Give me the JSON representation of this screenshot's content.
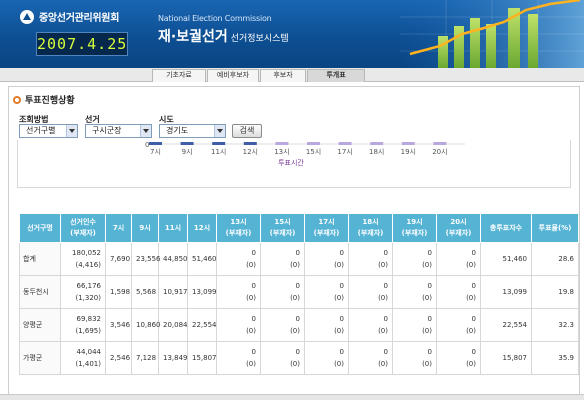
{
  "header": {
    "org_name": "중앙선거관리위원회",
    "date": "2007.4.25",
    "eng_title": "National Election Commission",
    "kor_title": "재·보궐선거",
    "kor_subtitle": "선거정보시스템"
  },
  "tabs": [
    {
      "label": "기초자료"
    },
    {
      "label": "예비후보자"
    },
    {
      "label": "후보자"
    },
    {
      "label": "투개표"
    }
  ],
  "section": {
    "title": "투표진행상황"
  },
  "filters": {
    "method_label": "조회방법",
    "method_value": "선거구별",
    "election_label": "선거",
    "election_value": "구시군장",
    "sido_label": "시도",
    "sido_value": "경기도",
    "search_label": "검색"
  },
  "chart_data": {
    "type": "bar",
    "categories": [
      "7시",
      "9시",
      "11시",
      "12시",
      "13시",
      "15시",
      "17시",
      "18시",
      "19시",
      "20시"
    ],
    "xlabel": "투표시간",
    "y_tick_label": "0",
    "colors": {
      "future_tick": "#b9a7df",
      "past_tick": "#3e5fa8"
    }
  },
  "table": {
    "headers": [
      [
        "선거구명"
      ],
      [
        "선거인수",
        "(부재자)"
      ],
      [
        "7시"
      ],
      [
        "9시"
      ],
      [
        "11시"
      ],
      [
        "12시"
      ],
      [
        "13시",
        "(부재자)"
      ],
      [
        "15시",
        "(부재자)"
      ],
      [
        "17시",
        "(부재자)"
      ],
      [
        "18시",
        "(부재자)"
      ],
      [
        "19시",
        "(부재자)"
      ],
      [
        "20시",
        "(부재자)"
      ],
      [
        "총투표자수"
      ],
      [
        "투표율(%)"
      ]
    ],
    "rows": [
      {
        "name": "합계",
        "electors": "180,052",
        "absentee": "(4,416)",
        "h7": "7,690",
        "h9": "23,556",
        "h11": "44,850",
        "h12": "51,460",
        "late": [
          [
            "0",
            "(0)"
          ],
          [
            "0",
            "(0)"
          ],
          [
            "0",
            "(0)"
          ],
          [
            "0",
            "(0)"
          ],
          [
            "0",
            "(0)"
          ],
          [
            "0",
            "(0)"
          ]
        ],
        "total": "51,460",
        "rate": "28.6"
      },
      {
        "name": "동두천시",
        "electors": "66,176",
        "absentee": "(1,320)",
        "h7": "1,598",
        "h9": "5,568",
        "h11": "10,917",
        "h12": "13,099",
        "late": [
          [
            "0",
            "(0)"
          ],
          [
            "0",
            "(0)"
          ],
          [
            "0",
            "(0)"
          ],
          [
            "0",
            "(0)"
          ],
          [
            "0",
            "(0)"
          ],
          [
            "0",
            "(0)"
          ]
        ],
        "total": "13,099",
        "rate": "19.8"
      },
      {
        "name": "양평군",
        "electors": "69,832",
        "absentee": "(1,695)",
        "h7": "3,546",
        "h9": "10,860",
        "h11": "20,084",
        "h12": "22,554",
        "late": [
          [
            "0",
            "(0)"
          ],
          [
            "0",
            "(0)"
          ],
          [
            "0",
            "(0)"
          ],
          [
            "0",
            "(0)"
          ],
          [
            "0",
            "(0)"
          ],
          [
            "0",
            "(0)"
          ]
        ],
        "total": "22,554",
        "rate": "32.3"
      },
      {
        "name": "가평군",
        "electors": "44,044",
        "absentee": "(1,401)",
        "h7": "2,546",
        "h9": "7,128",
        "h11": "13,849",
        "h12": "15,807",
        "late": [
          [
            "0",
            "(0)"
          ],
          [
            "0",
            "(0)"
          ],
          [
            "0",
            "(0)"
          ],
          [
            "0",
            "(0)"
          ],
          [
            "0",
            "(0)"
          ],
          [
            "0",
            "(0)"
          ]
        ],
        "total": "15,807",
        "rate": "35.9"
      }
    ]
  }
}
